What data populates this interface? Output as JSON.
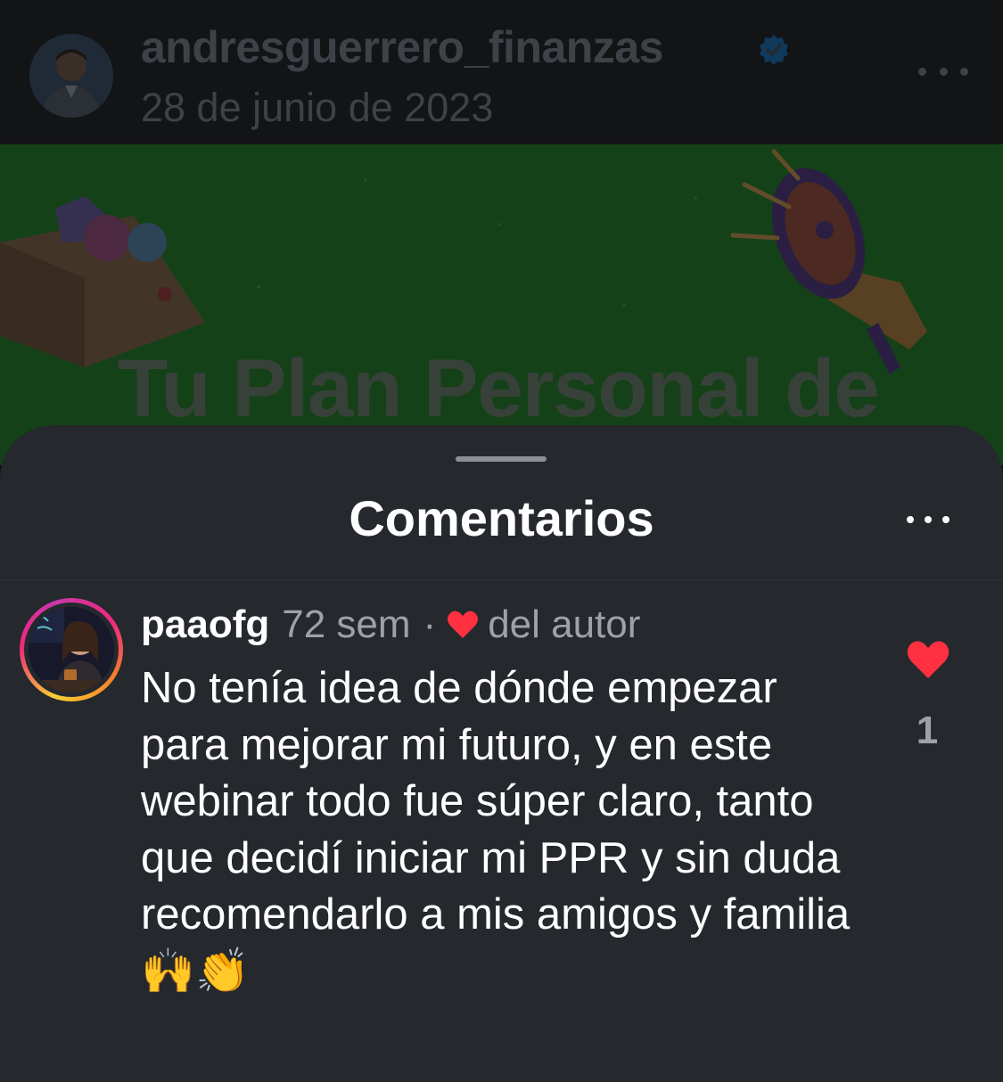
{
  "post": {
    "username": "andresguerrero_finanzas",
    "date": "28 de junio de 2023",
    "banner_text": "Tu Plan Personal de"
  },
  "sheet": {
    "title": "Comentarios"
  },
  "comment": {
    "username": "paaofg",
    "time": "72 sem",
    "separator": "·",
    "author_label": "del autor",
    "text": "No tenía idea de dónde empezar para mejorar mi futuro, y en este webinar todo fue súper claro, tanto que decidí iniciar mi PPR y sin duda recomendarlo a mis amigos y familia 🙌👏",
    "like_count": "1"
  },
  "colors": {
    "sheet_bg": "#25282d",
    "banner_green": "#1e5a22",
    "heart_red": "#ff3040",
    "verified_blue": "#0095f6",
    "muted_text": "#9ea2a8"
  }
}
